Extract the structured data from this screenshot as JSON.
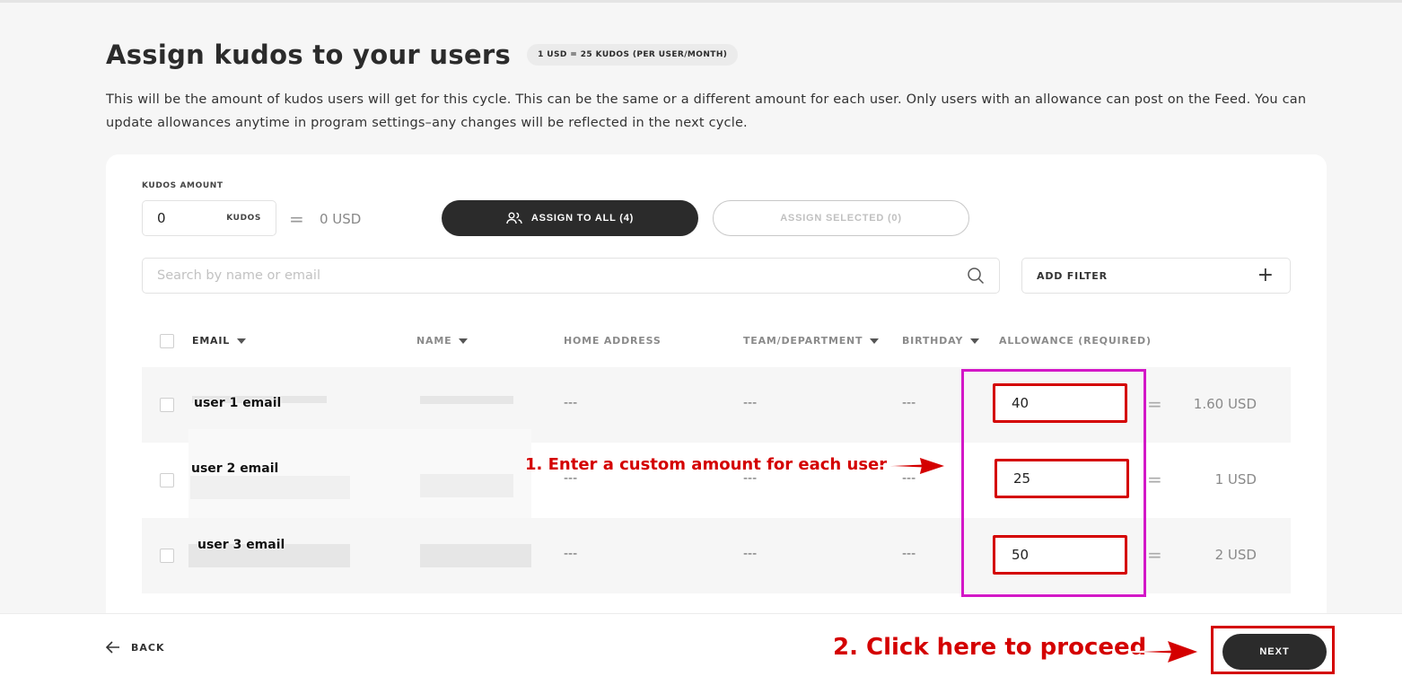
{
  "header": {
    "title": "Assign kudos to your users",
    "rate_badge": "1 USD = 25 KUDOS (PER USER/MONTH)",
    "description": "This will be the amount of kudos users will get for this cycle. This can be the same or a different amount for each user. Only users with an allowance can post on the Feed. You can update allowances anytime in program settings–any changes will be reflected in the next cycle."
  },
  "controls": {
    "kudos_label": "KUDOS AMOUNT",
    "kudos_value": "0",
    "kudos_unit": "KUDOS",
    "equals": "=",
    "usd_value": "0 USD",
    "assign_all_label": "ASSIGN TO ALL (4)",
    "assign_selected_label": "ASSIGN SELECTED (0)",
    "search_placeholder": "Search by name or email",
    "filter_label": "ADD FILTER",
    "filter_plus": "+"
  },
  "table": {
    "columns": {
      "email": "EMAIL",
      "name": "NAME",
      "home_address": "HOME ADDRESS",
      "team": "TEAM/DEPARTMENT",
      "birthday": "BIRTHDAY",
      "allowance": "ALLOWANCE (REQUIRED)"
    },
    "rows": [
      {
        "email": "user 1 email",
        "home_address": "---",
        "team": "---",
        "birthday": "---",
        "allowance": "40",
        "equals": "=",
        "usd": "1.60 USD"
      },
      {
        "email": "user 2 email",
        "home_address": "---",
        "team": "---",
        "birthday": "---",
        "allowance": "25",
        "equals": "=",
        "usd": "1 USD"
      },
      {
        "email": "user 3 email",
        "home_address": "---",
        "team": "---",
        "birthday": "---",
        "allowance": "50",
        "equals": "=",
        "usd": "2 USD"
      }
    ]
  },
  "annotations": {
    "step1": "1. Enter a custom amount for each user",
    "step2": "2. Click here to proceed",
    "highlight_color": "#d318c7",
    "arrow_color": "#d40000"
  },
  "footer": {
    "back_label": "BACK",
    "next_label": "NEXT"
  },
  "colors": {
    "primary_button": "#2b2b2b",
    "background": "#f6f6f6",
    "annotation_red": "#d40000"
  }
}
